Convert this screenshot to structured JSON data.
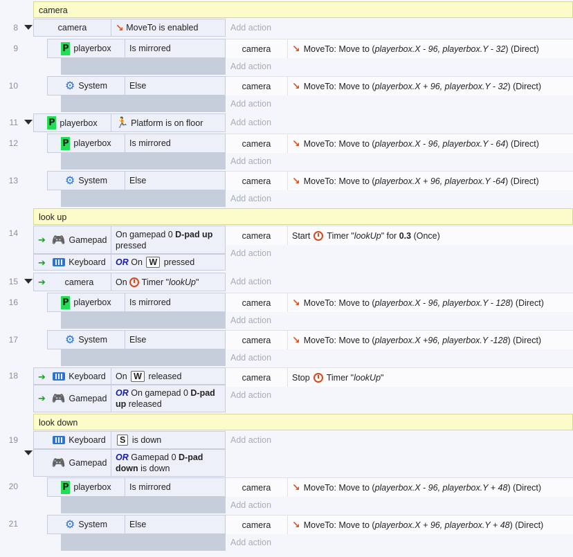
{
  "events": {
    "g1": "camera",
    "e8": {
      "num": "8",
      "obj": "camera",
      "text": "MoveTo is enabled"
    },
    "e9": {
      "num": "9",
      "obj": "playerbox",
      "text": "Is mirrored",
      "aobj": "camera",
      "a_pre": "MoveTo: Move to (",
      "a_x": "playerbox.X - 96, playerbox.Y - 32",
      "a_post": ") (Direct)"
    },
    "e10": {
      "num": "10",
      "obj": "System",
      "text": "Else",
      "aobj": "camera",
      "a_pre": "MoveTo: Move to (",
      "a_x": "playerbox.X + 96, playerbox.Y - 32",
      "a_post": ") (Direct)"
    },
    "e11": {
      "num": "11",
      "obj": "playerbox",
      "text": "Platform is on floor"
    },
    "e12": {
      "num": "12",
      "obj": "playerbox",
      "text": "Is mirrored",
      "aobj": "camera",
      "a_pre": "MoveTo: Move to (",
      "a_x": "playerbox.X - 96, playerbox.Y - 64",
      "a_post": ") (Direct)"
    },
    "e13": {
      "num": "13",
      "obj": "System",
      "text": "Else",
      "aobj": "camera",
      "a_pre": "MoveTo: Move to (",
      "a_x": "playerbox.X + 96, playerbox.Y -64",
      "a_post": ") (Direct)"
    },
    "g2": "look up",
    "e14": {
      "num": "14",
      "obj": "Gamepad",
      "t1": "On gamepad 0 ",
      "t1b": "D-pad up",
      "t2": "pressed",
      "obj2": "Keyboard",
      "or": "OR",
      "k_on": "On",
      "key": "W",
      "k_post": "pressed",
      "aobj": "camera",
      "a_start": "Start",
      "a_timer": "Timer \"",
      "a_name": "lookUp",
      "a_for": "\" for ",
      "a_val": "0.3",
      "a_once": " (Once)"
    },
    "e15": {
      "num": "15",
      "obj": "camera",
      "on": "On",
      "timer": "Timer \"",
      "name": "lookUp",
      "close": "\""
    },
    "e16": {
      "num": "16",
      "obj": "playerbox",
      "text": "Is mirrored",
      "aobj": "camera",
      "a_pre": "MoveTo: Move to (",
      "a_x": "playerbox.X - 96, playerbox.Y - 128",
      "a_post": ") (Direct)"
    },
    "e17": {
      "num": "17",
      "obj": "System",
      "text": "Else",
      "aobj": "camera",
      "a_pre": "MoveTo: Move to (",
      "a_x": "playerbox.X +96, playerbox.Y -128",
      "a_post": ") (Direct)"
    },
    "e18": {
      "num": "18",
      "obj": "Keyboard",
      "on": "On",
      "key": "W",
      "post": "released",
      "obj2": "Gamepad",
      "or": "OR",
      "t1": " On gamepad 0 ",
      "t1b": "D-pad",
      "t2b": "up",
      "t2": " released",
      "aobj": "camera",
      "a_stop": "Stop",
      "a_timer": "Timer \"",
      "a_name": "lookUp",
      "a_close": "\""
    },
    "g3": "look down",
    "e19": {
      "num": "19",
      "obj": "Keyboard",
      "key": "S",
      "post": "is down",
      "obj2": "Gamepad",
      "or": "OR",
      "t1": " Gamepad 0 ",
      "t1b": "D-pad",
      "t2b": "down",
      "t2": " is down"
    },
    "e20": {
      "num": "20",
      "obj": "playerbox",
      "text": "Is mirrored",
      "aobj": "camera",
      "a_pre": "MoveTo: Move to (",
      "a_x": "playerbox.X - 96, playerbox.Y + 48",
      "a_post": ") (Direct)"
    },
    "e21": {
      "num": "21",
      "obj": "System",
      "text": "Else",
      "aobj": "camera",
      "a_pre": "MoveTo: Move to (",
      "a_x": "playerbox.X + 96, playerbox.Y + 48",
      "a_post": ") (Direct)"
    }
  },
  "ui": {
    "add_action": "Add action"
  },
  "icons": {
    "playerbox": "P-sprite-icon",
    "system": "gear-icon",
    "move": "moveto-icon",
    "timer": "timer-icon",
    "gamepad": "gamepad-icon",
    "keyboard": "keyboard-icon",
    "platform": "platform-icon",
    "trigger": "trigger-arrow-icon",
    "collapse": "collapse-triangle-icon"
  },
  "colors": {
    "group_bg": "#fcfccb",
    "or": "#1a1aa5",
    "trigger": "#18a020",
    "icon_blue": "#2b74d1",
    "icon_orange": "#e05018"
  }
}
